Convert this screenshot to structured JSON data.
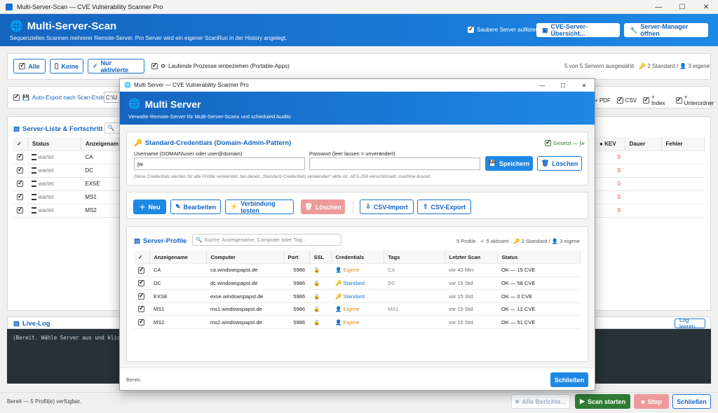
{
  "window": {
    "title": "Multi-Server-Scan — CVE Vulnerability Scanner Pro"
  },
  "header": {
    "title": "Multi-Server-Scan",
    "subtitle": "Sequenzielles Scannen mehrerer Remote-Server. Pro Server wird ein eigener ScanRun in der History angelegt.",
    "clean_servers_label": "Saubere Server auflisten",
    "cve_overview_label": "CVE-Server-Übersicht...",
    "server_manager_label": "Server-Manager öffnen"
  },
  "selection": {
    "all_label": "Alle",
    "none_label": "Keine",
    "only_active_label": "Nur aktivierte",
    "include_processes_label": "Laufende Prozesse einbeziehen (Portable-Apps)",
    "summary": "5 von 5 Servern ausgewählt · 🔑 2 Standard / 👤 3 eigene"
  },
  "export": {
    "auto_export_label": "Auto-Export nach Scan-Ende",
    "path_value": "C:\\U",
    "pdf_label": "PDF",
    "csv_label": "CSV",
    "index_label": "+ Index",
    "subfolder_label": "+ Unterordner"
  },
  "server_list": {
    "title": "Server-Liste & Fortschritt",
    "columns": [
      "✓",
      "Status",
      "Anzeigenam"
    ],
    "right_columns": [
      "KEV",
      "Dauer",
      "Fehler"
    ],
    "rows": [
      {
        "status": "wartet",
        "name": "CA",
        "kev": "0"
      },
      {
        "status": "wartet",
        "name": "DC",
        "kev": "0"
      },
      {
        "status": "wartet",
        "name": "EXSE",
        "kev": "0"
      },
      {
        "status": "wartet",
        "name": "MS1",
        "kev": "0"
      },
      {
        "status": "wartet",
        "name": "MS2",
        "kev": "0"
      }
    ]
  },
  "live_log": {
    "title": "Live-Log",
    "clear_label": "Log leeren",
    "text": "(Bereit. Wähle Server aus und klicke „Sca"
  },
  "status_bar": {
    "text": "Bereit — 5 Profil(e) verfügbar.",
    "all_reports_label": "Alle Berichte...",
    "start_label": "Scan starten",
    "stop_label": "Stop",
    "close_label": "Schließen"
  },
  "modal": {
    "window_title": "Multi Server — CVE Vulnerability Scanner Pro",
    "title": "Multi Server",
    "subtitle": "Verwalte Remote-Server für Multi-Server-Scans und scheduled Audits",
    "credentials": {
      "title": "Standard-Credentials (Domain-Admin-Pattern)",
      "set_label": "Gesetzt — jw",
      "username_label": "Username (DOMAIN\\user oder user@domain)",
      "username_value": "jw",
      "password_label": "Passwort (leer lassen = unverändert)",
      "save_label": "Speichern",
      "delete_label": "Löschen",
      "note": "Diese Credentials werden für alle Profile verwendet, bei denen „Standard-Credentials verwenden“ aktiv ist. AES-256 verschlüsselt, machine-bound."
    },
    "toolbar": {
      "new_label": "Neu",
      "edit_label": "Bearbeiten",
      "test_label": "Verbindung testen",
      "delete_label": "Löschen",
      "csv_import_label": "CSV-Import",
      "csv_export_label": "CSV-Export"
    },
    "profiles": {
      "title": "Server-Profile",
      "search_placeholder": "Suche: Anzeigename, Computer oder Tag...",
      "summary": "5 Profile · ✓ 5 aktiviert · 🔑 2 Standard / 👤 3 eigene",
      "columns": [
        "✓",
        "Anzeigename",
        "Computer",
        "Port",
        "SSL",
        "Credentials",
        "Tags",
        "Letzter Scan",
        "Status"
      ],
      "rows": [
        {
          "name": "CA",
          "computer": "ca.windowspapst.de",
          "port": "5986",
          "cred": "Eigene",
          "cred_type": "own",
          "tags": "CA",
          "last": "vor 43 Min.",
          "status": "OK — 15 CVE"
        },
        {
          "name": "DC",
          "computer": "dc.windowspapst.de",
          "port": "5986",
          "cred": "Standard",
          "cred_type": "std",
          "tags": "DC",
          "last": "vor 15 Std.",
          "status": "OK — 58 CVE"
        },
        {
          "name": "EXSE",
          "computer": "exse.windowspapst.de",
          "port": "5986",
          "cred": "Standard",
          "cred_type": "std",
          "tags": "",
          "last": "vor 15 Std.",
          "status": "OK — 0 CVE"
        },
        {
          "name": "MS1",
          "computer": "ms1.windowspapst.de",
          "port": "5986",
          "cred": "Eigene",
          "cred_type": "own",
          "tags": "MS1",
          "last": "vor 15 Std.",
          "status": "OK — 12 CVE"
        },
        {
          "name": "MS2",
          "computer": "ms2.windowspapst.de",
          "port": "5986",
          "cred": "Eigene",
          "cred_type": "own",
          "tags": "",
          "last": "vor 15 Std.",
          "status": "OK — 51 CVE"
        }
      ]
    },
    "footer": {
      "status": "Bereit.",
      "close_label": "Schließen"
    }
  }
}
